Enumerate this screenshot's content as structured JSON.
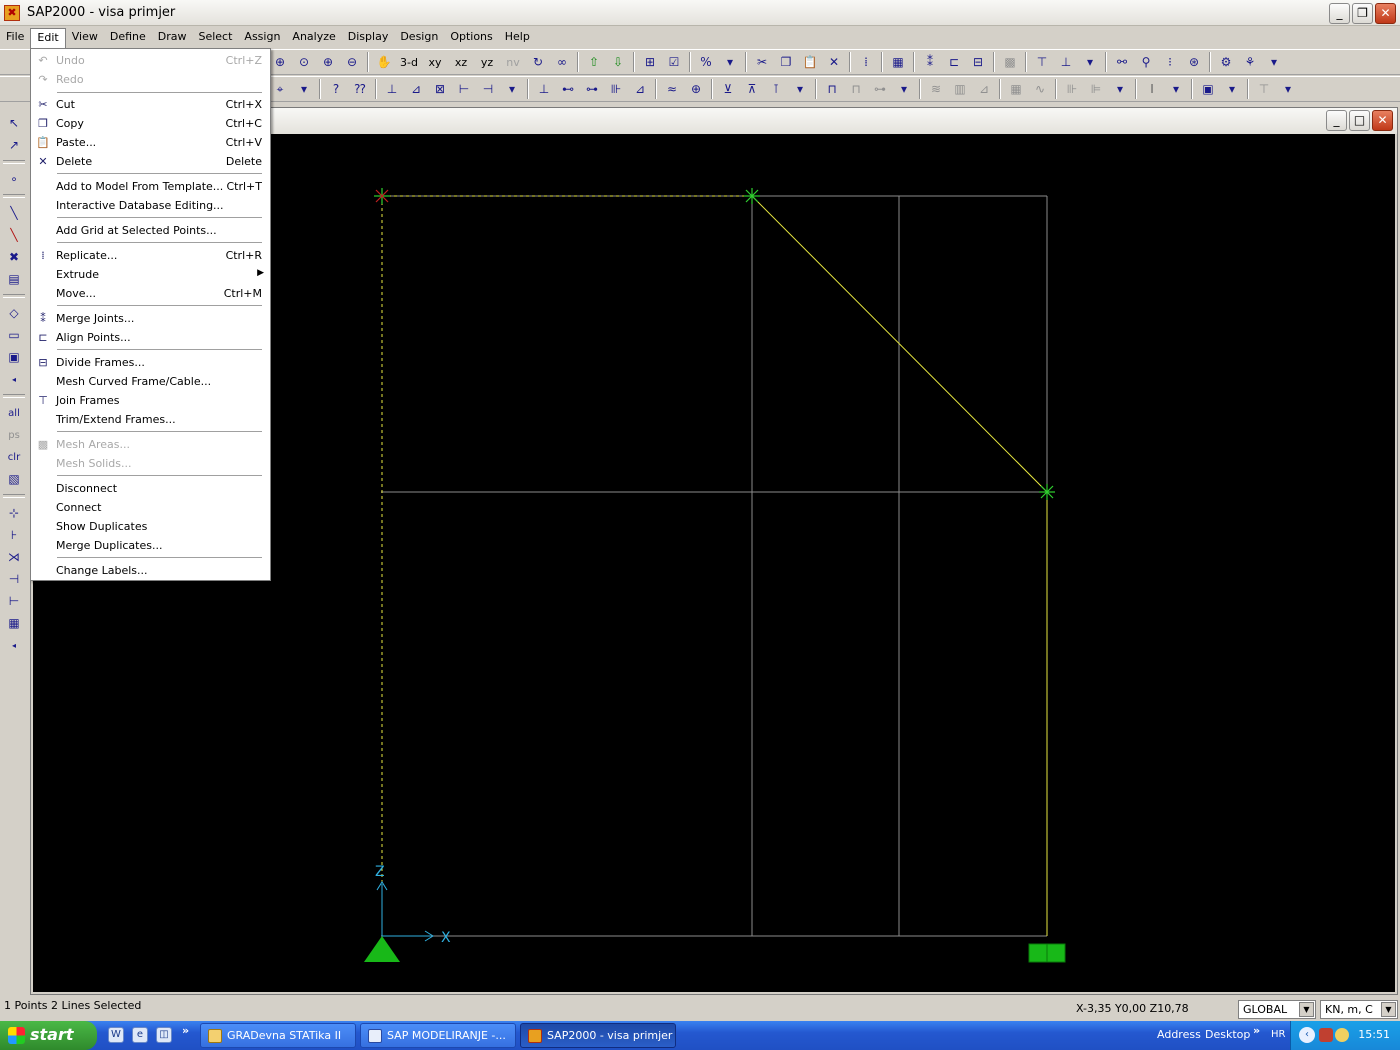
{
  "window": {
    "title": "SAP2000 - visa primjer",
    "min": "_",
    "max": "❐",
    "close": "✕"
  },
  "menubar": [
    "File",
    "Edit",
    "View",
    "Define",
    "Draw",
    "Select",
    "Assign",
    "Analyze",
    "Display",
    "Design",
    "Options",
    "Help"
  ],
  "toolbar": {
    "view_3d": "3-d",
    "view_xy": "xy",
    "view_xz": "xz",
    "view_yz": "yz",
    "view_nv": "nv"
  },
  "edit_menu": {
    "undo": {
      "label": "Undo",
      "shortcut": "Ctrl+Z"
    },
    "redo": {
      "label": "Redo",
      "shortcut": ""
    },
    "cut": {
      "label": "Cut",
      "shortcut": "Ctrl+X"
    },
    "copy": {
      "label": "Copy",
      "shortcut": "Ctrl+C"
    },
    "paste": {
      "label": "Paste...",
      "shortcut": "Ctrl+V"
    },
    "delete": {
      "label": "Delete",
      "shortcut": "Delete"
    },
    "add_template": {
      "label": "Add to Model From Template...",
      "shortcut": "Ctrl+T"
    },
    "interactive_db": {
      "label": "Interactive Database Editing...",
      "shortcut": ""
    },
    "add_grid": {
      "label": "Add Grid at Selected Points...",
      "shortcut": ""
    },
    "replicate": {
      "label": "Replicate...",
      "shortcut": "Ctrl+R"
    },
    "extrude": {
      "label": "Extrude",
      "shortcut": ""
    },
    "move": {
      "label": "Move...",
      "shortcut": "Ctrl+M"
    },
    "merge_joints": {
      "label": "Merge Joints...",
      "shortcut": ""
    },
    "align_points": {
      "label": "Align Points...",
      "shortcut": ""
    },
    "divide_frames": {
      "label": "Divide Frames...",
      "shortcut": ""
    },
    "mesh_curved": {
      "label": "Mesh Curved Frame/Cable...",
      "shortcut": ""
    },
    "join_frames": {
      "label": "Join Frames",
      "shortcut": ""
    },
    "trim_extend": {
      "label": "Trim/Extend Frames...",
      "shortcut": ""
    },
    "mesh_areas": {
      "label": "Mesh Areas...",
      "shortcut": ""
    },
    "mesh_solids": {
      "label": "Mesh Solids...",
      "shortcut": ""
    },
    "disconnect": {
      "label": "Disconnect",
      "shortcut": ""
    },
    "connect": {
      "label": "Connect",
      "shortcut": ""
    },
    "show_duplicates": {
      "label": "Show Duplicates",
      "shortcut": ""
    },
    "merge_duplicates": {
      "label": "Merge Duplicates...",
      "shortcut": ""
    },
    "change_labels": {
      "label": "Change Labels...",
      "shortcut": ""
    }
  },
  "viewport": {
    "axis_x": "X",
    "axis_z": "Z",
    "background": "#000000",
    "grid_color": "#8c8c8c",
    "frame_color": "#e8e840",
    "joint_color": "#30d030",
    "axis_color": "#30b0e0"
  },
  "status": {
    "selection": "1 Points  2 Lines Selected",
    "coords": "X-3,35  Y0,00  Z10,78",
    "coord_system": "GLOBAL",
    "units": "KN, m, C"
  },
  "taskbar": {
    "start": "start",
    "tasks": [
      "GRADevna  STATika  II",
      "SAP  MODELIRANJE -...",
      "SAP2000 - visa primjer"
    ],
    "address": "Address",
    "desktop": "Desktop",
    "lang": "HR",
    "time": "15:51"
  }
}
